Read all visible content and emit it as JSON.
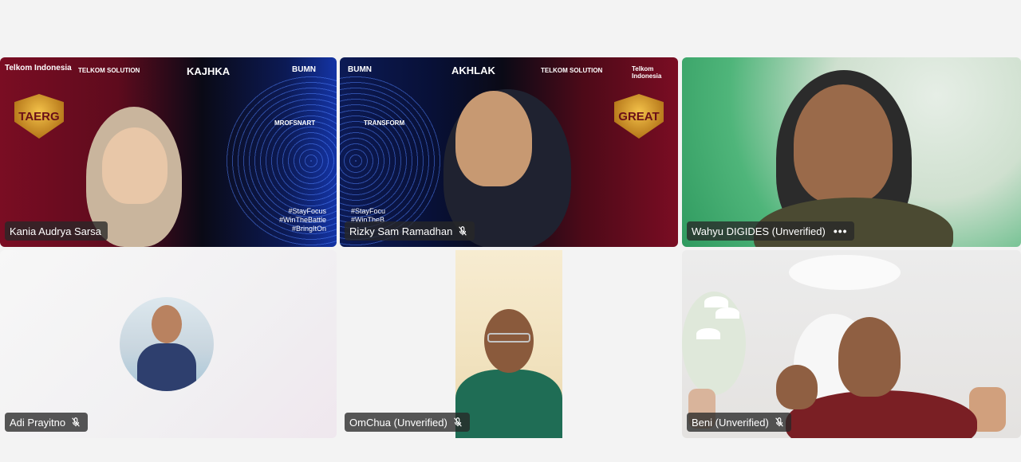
{
  "participants": [
    {
      "name": "Kania Audrya Sarsa",
      "muted": false
    },
    {
      "name": "Rizky Sam Ramadhan",
      "muted": true
    },
    {
      "name": "Wahyu DIGIDES (Unverified)",
      "muted": false,
      "more": "•••"
    },
    {
      "name": "Adi Prayitno",
      "muted": true
    },
    {
      "name": "OmChua (Unverified)",
      "muted": true
    },
    {
      "name": "Beni (Unverified)",
      "muted": true
    }
  ],
  "backgrounds": {
    "akhlak": "AKHLAK",
    "akhlak_mirrored": "KAJHKA",
    "bumn": "BUMN",
    "telkom_solution": "TELKOM SOLUTION",
    "telkom_indonesia": "Telkom Indonesia",
    "great": "GREAT",
    "great_mirrored": "TAERG",
    "transform": "TRANSFORM",
    "transform_mirrored": "MROFSNART",
    "hashtags": "#StayFocus\n#WinTheBattle\n#BringItOn",
    "hashtags_partial": "#StayFocu\n#WinTheB"
  },
  "colors": {
    "chip_bg": "#282828",
    "brand_red": "#7a0d23",
    "brand_blue": "#1434a5"
  }
}
